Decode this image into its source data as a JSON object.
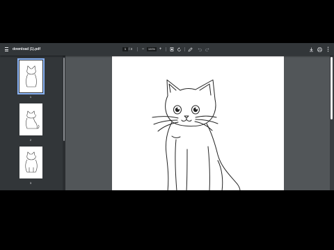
{
  "toolbar": {
    "menu_icon": "menu-icon",
    "file_name": "download (1).pdf",
    "page_current": "1",
    "page_total": "/ 3",
    "zoom_out_glyph": "−",
    "zoom_value": "100%",
    "zoom_in_glyph": "+",
    "fit_icon": "fit-page-icon",
    "rotate_icon": "rotate-icon",
    "annotate_icon": "pen-icon",
    "undo_icon": "undo-icon",
    "redo_icon": "redo-icon",
    "download_icon": "download-icon",
    "print_icon": "print-icon",
    "more_icon": "more-vert-icon"
  },
  "thumbnails": [
    {
      "label": "1",
      "active": true
    },
    {
      "label": "2",
      "active": false
    },
    {
      "label": "3",
      "active": false
    }
  ],
  "colors": {
    "toolbar": "#323639",
    "viewer_bg": "#525659",
    "active_outline": "#8ab4f8"
  }
}
